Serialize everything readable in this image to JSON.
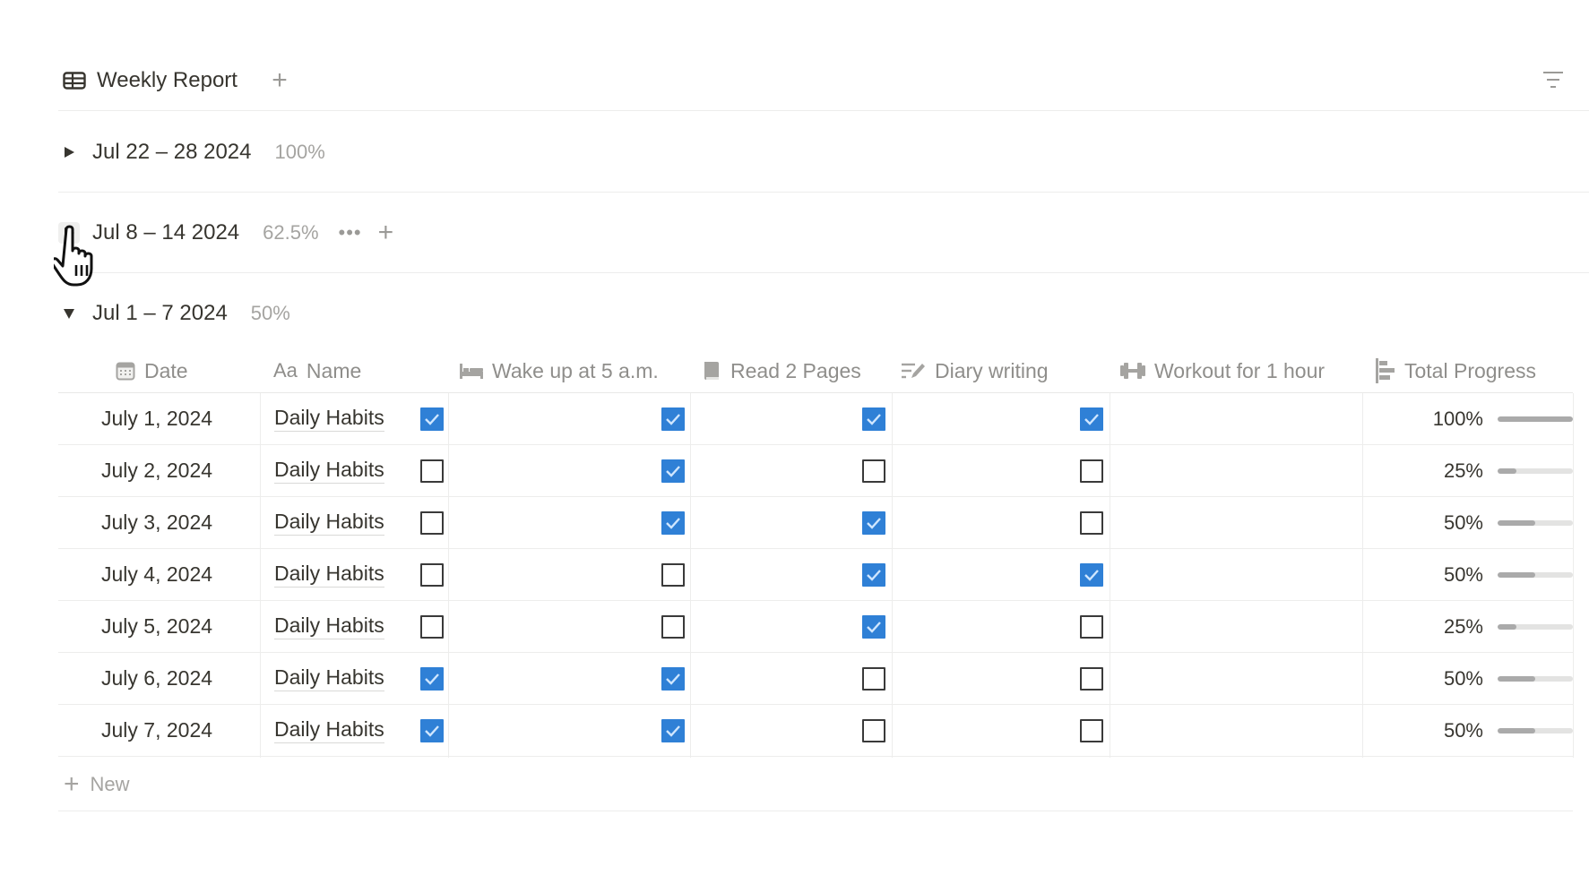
{
  "view": {
    "title": "Weekly Report",
    "icon": "table-icon",
    "add_view_label": "+",
    "filter_icon": "filter-icon"
  },
  "groups": [
    {
      "title": "Jul 22 – 28 2024",
      "percent": "100%",
      "expanded": false
    },
    {
      "title": "Jul 8 – 14 2024",
      "percent": "62.5%",
      "expanded": false,
      "hovered": true,
      "more_label": "•••",
      "add_label": "+"
    },
    {
      "title": "Jul 1 – 7 2024",
      "percent": "50%",
      "expanded": true
    }
  ],
  "table": {
    "columns": [
      {
        "key": "date",
        "label": "Date",
        "icon": "calendar-icon"
      },
      {
        "key": "name",
        "label": "Name",
        "icon": "text-aa-icon",
        "icon_text": "Aa"
      },
      {
        "key": "wake",
        "label": "Wake up at 5 a.m.",
        "icon": "bed-icon"
      },
      {
        "key": "read",
        "label": "Read 2 Pages",
        "icon": "book-icon"
      },
      {
        "key": "diary",
        "label": "Diary writing",
        "icon": "pencil-lines-icon"
      },
      {
        "key": "workout",
        "label": "Workout for 1 hour",
        "icon": "dumbbell-icon"
      },
      {
        "key": "total",
        "label": "Total Progress",
        "icon": "bar-align-icon"
      }
    ],
    "rows": [
      {
        "date": "July 1, 2024",
        "name": "Daily Habits",
        "wake": true,
        "read": true,
        "diary": true,
        "workout": true,
        "total_label": "100%",
        "total": 1.0
      },
      {
        "date": "July 2, 2024",
        "name": "Daily Habits",
        "wake": false,
        "read": true,
        "diary": false,
        "workout": false,
        "total_label": "25%",
        "total": 0.25
      },
      {
        "date": "July 3, 2024",
        "name": "Daily Habits",
        "wake": false,
        "read": true,
        "diary": true,
        "workout": false,
        "total_label": "50%",
        "total": 0.5
      },
      {
        "date": "July 4, 2024",
        "name": "Daily Habits",
        "wake": false,
        "read": false,
        "diary": true,
        "workout": true,
        "total_label": "50%",
        "total": 0.5
      },
      {
        "date": "July 5, 2024",
        "name": "Daily Habits",
        "wake": false,
        "read": false,
        "diary": true,
        "workout": false,
        "total_label": "25%",
        "total": 0.25
      },
      {
        "date": "July 6, 2024",
        "name": "Daily Habits",
        "wake": true,
        "read": true,
        "diary": false,
        "workout": false,
        "total_label": "50%",
        "total": 0.5
      },
      {
        "date": "July 7, 2024",
        "name": "Daily Habits",
        "wake": true,
        "read": true,
        "diary": false,
        "workout": false,
        "total_label": "50%",
        "total": 0.5
      }
    ],
    "new_row_label": "New"
  },
  "colors": {
    "checkbox_checked": "#2f80d6",
    "progress_fill": "#aaaaaa",
    "progress_track": "#e3e3e2",
    "muted_text": "#9b9a97"
  }
}
